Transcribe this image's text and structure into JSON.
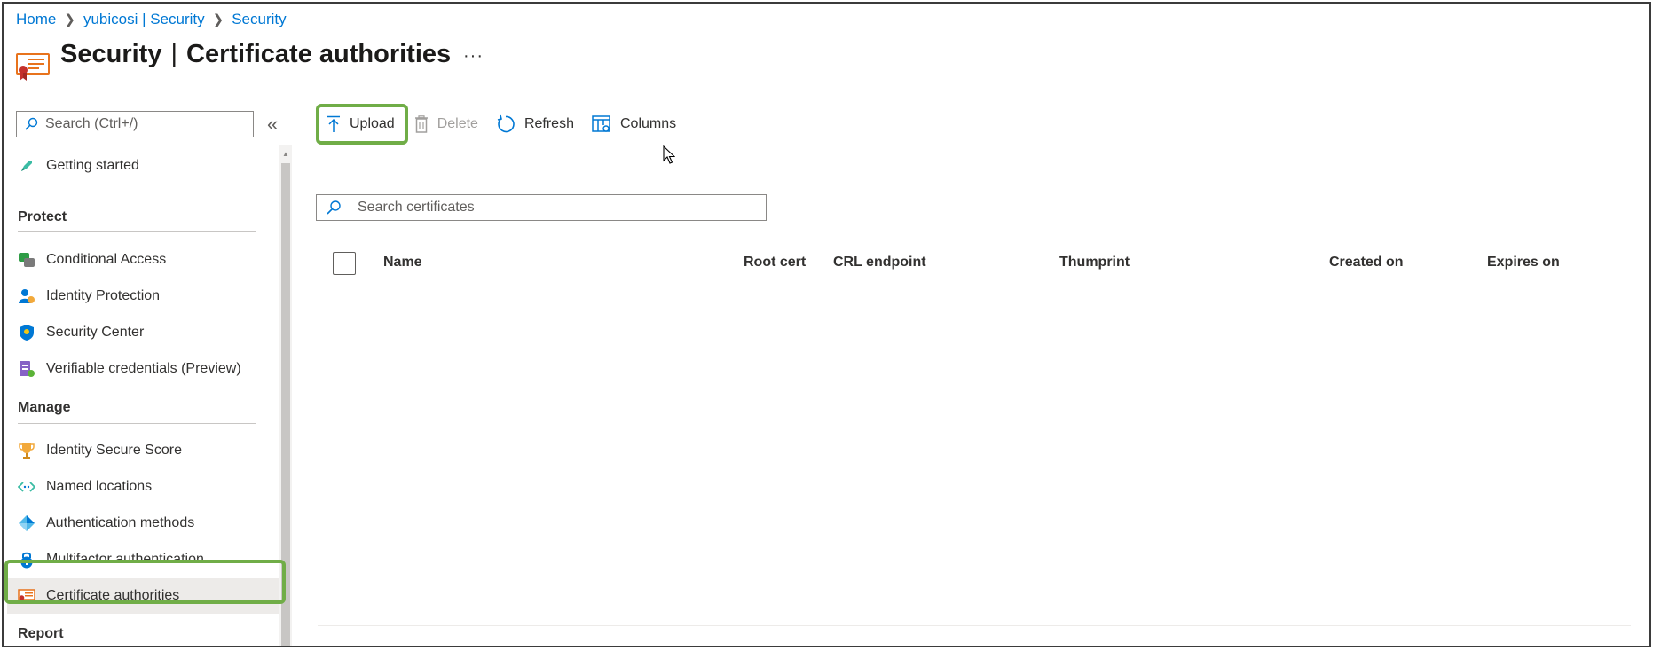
{
  "breadcrumb": {
    "items": [
      "Home",
      "yubicosi | Security",
      "Security"
    ]
  },
  "page": {
    "title_bold": "Security",
    "title_separator": "|",
    "title_rest": "Certificate authorities",
    "more_label": "···"
  },
  "sidebar": {
    "search_placeholder": "Search (Ctrl+/)",
    "collapse_label": "«",
    "getting_started": "Getting started",
    "sections": {
      "protect": "Protect",
      "manage": "Manage",
      "report": "Report"
    },
    "protect_items": [
      {
        "label": "Conditional Access",
        "icon": "conditional-access-icon"
      },
      {
        "label": "Identity Protection",
        "icon": "identity-protection-icon"
      },
      {
        "label": "Security Center",
        "icon": "security-center-icon"
      },
      {
        "label": "Verifiable credentials (Preview)",
        "icon": "verifiable-credentials-icon"
      }
    ],
    "manage_items": [
      {
        "label": "Identity Secure Score",
        "icon": "trophy-icon"
      },
      {
        "label": "Named locations",
        "icon": "named-locations-icon"
      },
      {
        "label": "Authentication methods",
        "icon": "authentication-methods-icon"
      },
      {
        "label": "Multifactor authentication",
        "icon": "mfa-lock-icon"
      },
      {
        "label": "Certificate authorities",
        "icon": "certificate-icon",
        "active": true
      }
    ]
  },
  "toolbar": {
    "upload": "Upload",
    "delete": "Delete",
    "refresh": "Refresh",
    "columns": "Columns"
  },
  "main": {
    "search_placeholder": "Search certificates",
    "columns": [
      "Name",
      "Root cert",
      "CRL endpoint",
      "Thumprint",
      "Created on",
      "Expires on"
    ]
  },
  "colors": {
    "accent": "#0078d4",
    "highlight": "#70ad47",
    "certificate_orange": "#e8731c"
  }
}
